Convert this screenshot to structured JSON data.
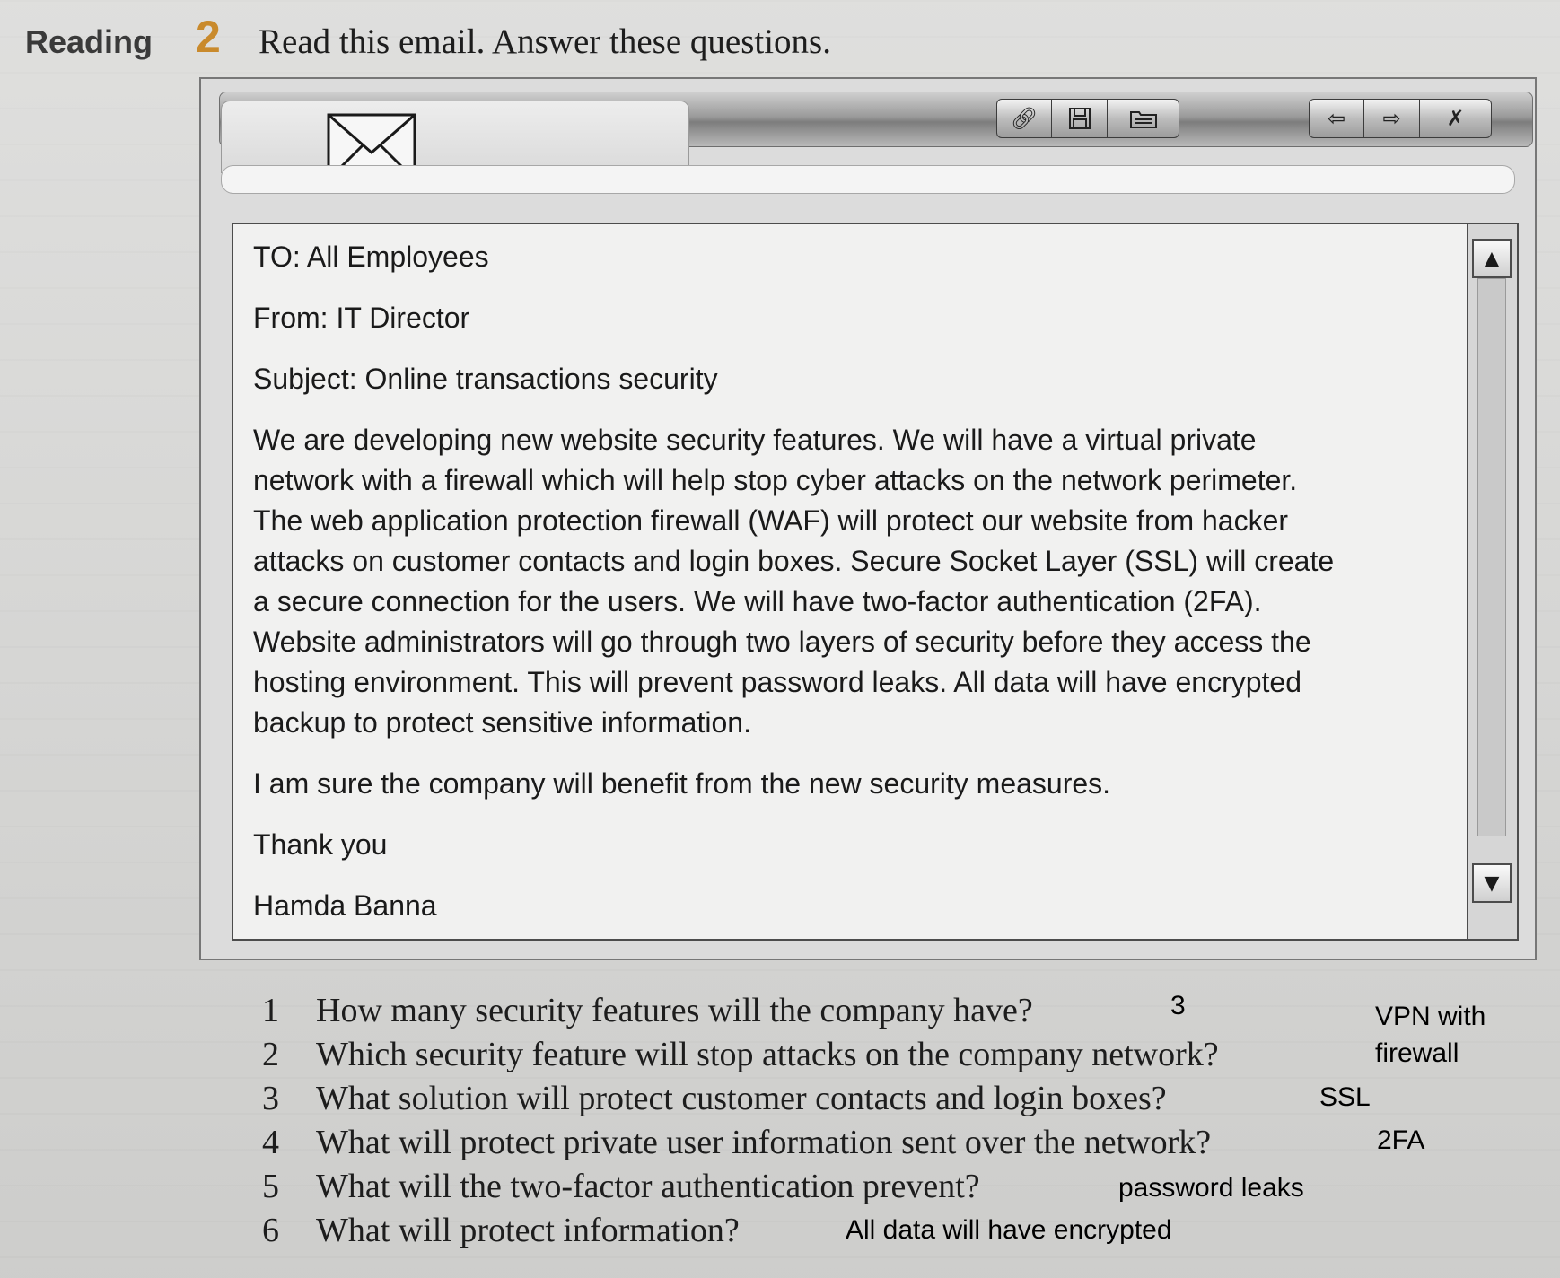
{
  "header": {
    "section": "Reading",
    "task_number": "2",
    "instruction": "Read this email. Answer these questions."
  },
  "toolbar": {
    "left_icons": [
      "link-icon",
      "save-icon",
      "folder-icon"
    ],
    "right_icons": [
      "back-arrow-icon",
      "forward-arrow-icon",
      "close-icon"
    ]
  },
  "email": {
    "to": "TO: All Employees",
    "from": "From: IT Director",
    "subject": "Subject: Online transactions security",
    "body_lines": [
      "We are developing new website security features. We will have a virtual private",
      "network with a firewall which will help stop cyber attacks on the network perimeter.",
      "The web application protection firewall (WAF) will protect our website from hacker",
      "attacks on customer contacts and login boxes. Secure Socket Layer (SSL) will create",
      "a secure connection for the users. We will have two-factor authentication (2FA).",
      "Website administrators will go through two layers of security before they access the",
      "hosting environment. This will prevent password leaks. All data will have encrypted",
      "backup to protect sensitive information."
    ],
    "closing": "I am sure the company will benefit from the new security measures.",
    "signoff": "Thank you",
    "signature": "Hamda Banna"
  },
  "questions": [
    {
      "number": "1",
      "text": "How many security features will the company have?",
      "answer": "3"
    },
    {
      "number": "2",
      "text": "Which security feature will stop attacks on the company network?",
      "answer": "VPN with\nfirewall"
    },
    {
      "number": "3",
      "text": "What solution will protect customer contacts and login boxes?",
      "answer": "SSL"
    },
    {
      "number": "4",
      "text": "What will protect private user information sent over the network?",
      "answer": "2FA"
    },
    {
      "number": "5",
      "text": "What will the two-factor authentication prevent?",
      "answer": "password leaks"
    },
    {
      "number": "6",
      "text": "What will protect information?",
      "answer": "All data will have encrypted"
    }
  ]
}
